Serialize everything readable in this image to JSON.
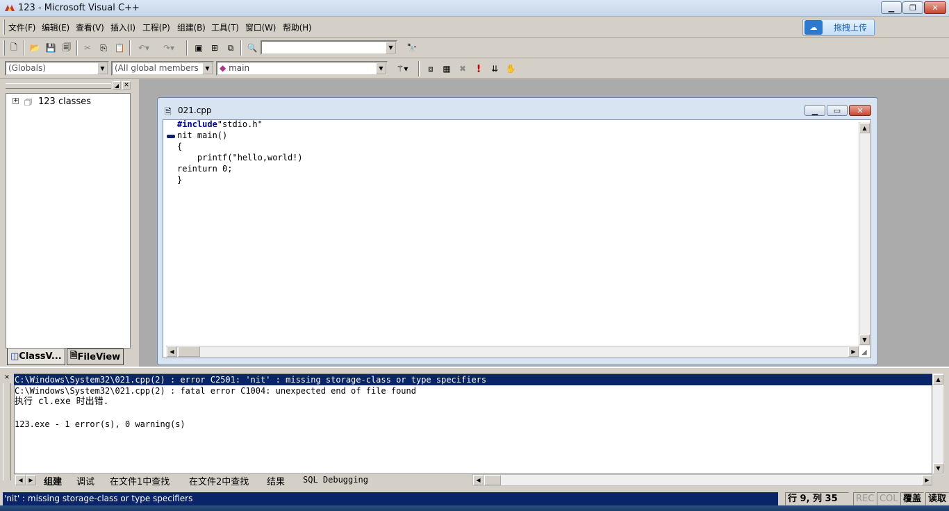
{
  "window": {
    "title": "123 - Microsoft Visual C++"
  },
  "menu": {
    "items": [
      "文件(F)",
      "编辑(E)",
      "查看(V)",
      "插入(I)",
      "工程(P)",
      "组建(B)",
      "工具(T)",
      "窗口(W)",
      "帮助(H)"
    ]
  },
  "upload": {
    "label": "拖拽上传"
  },
  "toolbar": {
    "find_combo_value": "",
    "scope_combo": "(Globals)",
    "members_combo": "(All global members",
    "function_combo": "main"
  },
  "workspace": {
    "tree_root": "123 classes",
    "tabs": [
      "ClassV...",
      "FileView"
    ]
  },
  "editor": {
    "file_name": "021.cpp",
    "lines": [
      {
        "kw": "#include",
        "text": "\"stdio.h\""
      },
      {
        "kw": "",
        "text": "nit main()"
      },
      {
        "kw": "",
        "text": "{"
      },
      {
        "kw": "",
        "text": "    printf(\"hello,world!)"
      },
      {
        "kw": "",
        "text": "reinturn 0;"
      },
      {
        "kw": "",
        "text": "}"
      }
    ]
  },
  "output": {
    "lines": [
      "C:\\Windows\\System32\\021.cpp(2) : error C2501: 'nit' : missing storage-class or type specifiers",
      "C:\\Windows\\System32\\021.cpp(2) : fatal error C1004: unexpected end of file found",
      "执行 cl.exe 时出错.",
      "",
      "123.exe - 1 error(s), 0 warning(s)"
    ],
    "tabs": [
      "组建",
      "调试",
      "在文件1中查找",
      "在文件2中查找",
      "结果",
      "SQL Debugging"
    ]
  },
  "status": {
    "message": "'nit' : missing storage-class or type specifiers",
    "position": "行 9, 列 35",
    "rec": "REC",
    "col": "COL",
    "ovr": "覆盖",
    "read": "读取"
  }
}
